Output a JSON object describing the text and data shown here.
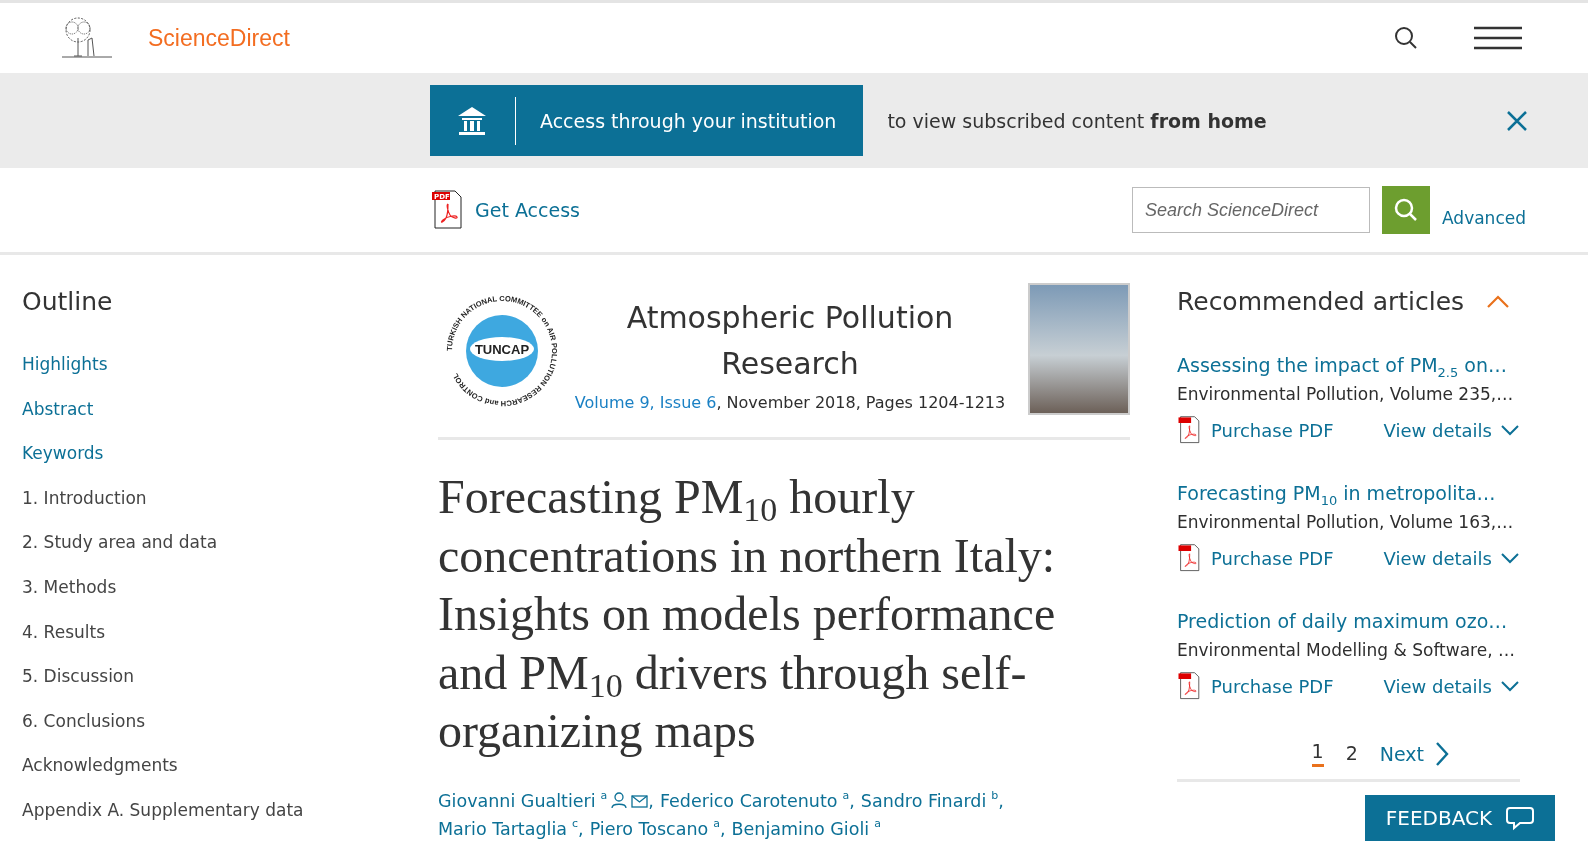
{
  "header": {
    "brand": "ScienceDirect"
  },
  "banner": {
    "button": "Access through your institution",
    "message": "to view subscribed content **from home**"
  },
  "access_bar": {
    "get_access": "Get Access",
    "pdf_badge": "PDF",
    "search": {
      "placeholder": "Search ScienceDirect"
    },
    "advanced": "Advanced"
  },
  "outline": {
    "title": "Outline",
    "items": [
      {
        "label": "Highlights",
        "kind": "link"
      },
      {
        "label": "Abstract",
        "kind": "link"
      },
      {
        "label": "Keywords",
        "kind": "link"
      },
      {
        "label": "1. Introduction",
        "kind": "section"
      },
      {
        "label": "2. Study area and data",
        "kind": "section"
      },
      {
        "label": "3. Methods",
        "kind": "section"
      },
      {
        "label": "4. Results",
        "kind": "section"
      },
      {
        "label": "5. Discussion",
        "kind": "section"
      },
      {
        "label": "6. Conclusions",
        "kind": "section"
      },
      {
        "label": "Acknowledgments",
        "kind": "section"
      },
      {
        "label": "Appendix A. Supplementary data",
        "kind": "section"
      }
    ]
  },
  "article": {
    "society_logo": {
      "text": "TUNCAP",
      "ring": "TURKISH NATIONAL COMMITTEE on AIR POLLUTION RESEARCH and CONTROL"
    },
    "journal": "Atmospheric Pollution Research",
    "volume": "Volume 9, Issue 6",
    "citation": ", November 2018, Pages 1204-1213",
    "title": "Forecasting PM$_{10}$ hourly concentrations in northern Italy: Insights on models performance and PM$_{10}$ drivers through self-organizing maps",
    "authors": [
      {
        "name": "Giovanni Gualtieri",
        "affiliation": "a",
        "contact": true,
        "separator": ","
      },
      {
        "name": "Federico Carotenuto",
        "affiliation": "a",
        "contact": false,
        "separator": ","
      },
      {
        "name": "Sandro Finardi",
        "affiliation": "b",
        "contact": false,
        "separator": ","
      },
      {
        "name": "Mario Tartaglia",
        "affiliation": "c",
        "contact": false,
        "separator": ","
      },
      {
        "name": "Piero Toscano",
        "affiliation": "a",
        "contact": false,
        "separator": ","
      },
      {
        "name": "Benjamino Gioli",
        "affiliation": "a",
        "contact": false
      }
    ]
  },
  "recommended": {
    "title": "Recommended articles",
    "expanded": true,
    "items": [
      {
        "title": "Assessing the impact of PM$_{2.5}$ on…",
        "source": "Environmental Pollution, Volume 235,…",
        "purchase": "Purchase PDF",
        "details": "View details"
      },
      {
        "title": "Forecasting PM$_{10}$ in metropolita…",
        "source": "Environmental Pollution, Volume 163,…",
        "purchase": "Purchase PDF",
        "details": "View details"
      },
      {
        "title": "Prediction of daily maximum ozo…",
        "source": "Environmental Modelling & Software, …",
        "purchase": "Purchase PDF",
        "details": "View details"
      }
    ],
    "pages": [
      {
        "label": "1",
        "selected": true
      },
      {
        "label": "2",
        "selected": false
      }
    ],
    "next": "Next"
  },
  "feedback": "FEEDBACK"
}
